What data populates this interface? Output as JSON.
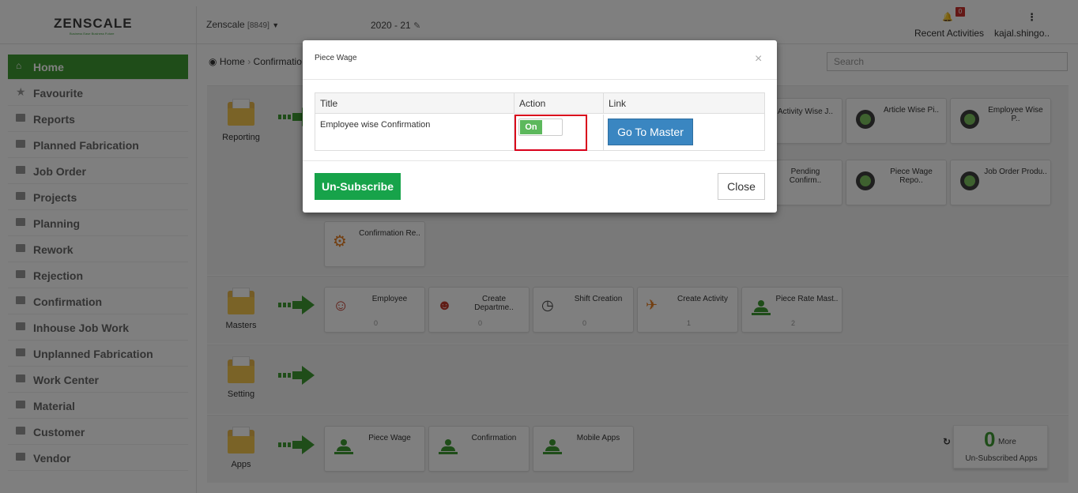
{
  "header": {
    "logo": "ZENSCALE",
    "logo_tagline": "Business Ease Business Future",
    "company": "Zenscale",
    "company_id": "[8849]",
    "year": "2020 - 21",
    "notification_count": "0",
    "recent_activities": "Recent Activities",
    "user": "kajal.shingo.."
  },
  "sidebar": {
    "items": [
      {
        "label": "Home",
        "active": true
      },
      {
        "label": "Favourite"
      },
      {
        "label": "Reports"
      },
      {
        "label": "Planned Fabrication"
      },
      {
        "label": "Job Order"
      },
      {
        "label": "Projects"
      },
      {
        "label": "Planning"
      },
      {
        "label": "Rework"
      },
      {
        "label": "Rejection"
      },
      {
        "label": "Confirmation"
      },
      {
        "label": "Inhouse Job Work"
      },
      {
        "label": "Unplanned Fabrication"
      },
      {
        "label": "Work Center"
      },
      {
        "label": "Material"
      },
      {
        "label": "Customer"
      },
      {
        "label": "Vendor"
      }
    ]
  },
  "breadcrumb": {
    "home": "Home",
    "current": "Confirmatio"
  },
  "search": {
    "placeholder": "Search"
  },
  "sections": {
    "reporting": {
      "label": "Reporting",
      "cards": [
        {
          "title": "Activity Wise J.."
        },
        {
          "title": "Article Wise Pi.."
        },
        {
          "title": "Employee Wise P.."
        },
        {
          "title": "Pending Confirm.."
        },
        {
          "title": "Piece Wage Repo.."
        },
        {
          "title": "Job Order Produ.."
        },
        {
          "title": "Confirmation Re.."
        }
      ]
    },
    "masters": {
      "label": "Masters",
      "cards": [
        {
          "title": "Employee",
          "count": "0"
        },
        {
          "title": "Create Departme..",
          "count": "0"
        },
        {
          "title": "Shift Creation",
          "count": "0"
        },
        {
          "title": "Create Activity",
          "count": "1"
        },
        {
          "title": "Piece Rate Mast..",
          "count": "2"
        }
      ]
    },
    "setting": {
      "label": "Setting"
    },
    "apps": {
      "label": "Apps",
      "cards": [
        {
          "title": "Piece Wage"
        },
        {
          "title": "Confirmation"
        },
        {
          "title": "Mobile Apps"
        }
      ]
    }
  },
  "unsubscribed": {
    "count": "0",
    "more": "More",
    "caption": "Un-Subscribed Apps"
  },
  "modal": {
    "title": "Piece Wage",
    "close_x": "×",
    "columns": [
      "Title",
      "Action",
      "Link"
    ],
    "row": {
      "title": "Employee wise Confirmation",
      "toggle": "On",
      "link": "Go To Master"
    },
    "unsubscribe_btn": "Un-Subscribe",
    "close_btn": "Close"
  }
}
